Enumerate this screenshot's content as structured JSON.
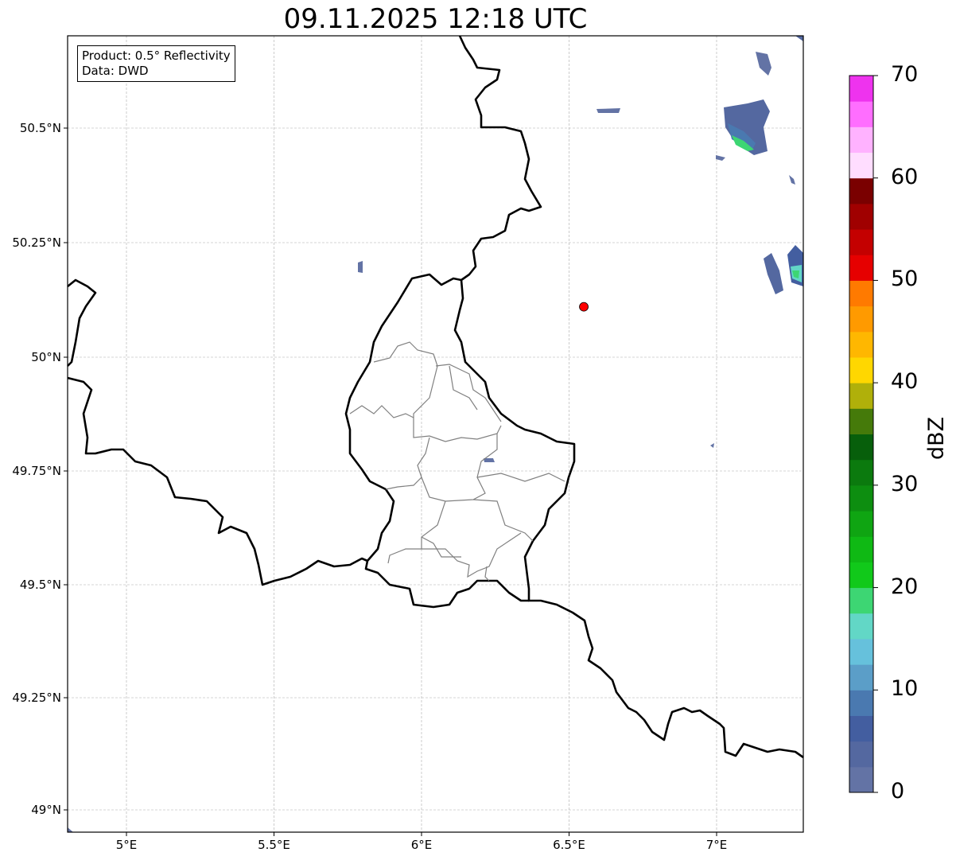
{
  "title": "09.11.2025 12:18 UTC",
  "info": {
    "product": "Product: 0.5° Reflectivity",
    "source": "Data: DWD"
  },
  "map": {
    "extent_lon": [
      4.8,
      7.3
    ],
    "extent_lat": [
      48.95,
      50.7
    ],
    "lon_ticks": [
      {
        "v": 5,
        "label": "5°E"
      },
      {
        "v": 5.5,
        "label": "5.5°E"
      },
      {
        "v": 6,
        "label": "6°E"
      },
      {
        "v": 6.5,
        "label": "6.5°E"
      },
      {
        "v": 7,
        "label": "7°E"
      }
    ],
    "lat_ticks": [
      {
        "v": 50.5,
        "label": "50.5°N"
      },
      {
        "v": 50.25,
        "label": "50.25°N"
      },
      {
        "v": 50,
        "label": "50°N"
      },
      {
        "v": 49.75,
        "label": "49.75°N"
      },
      {
        "v": 49.5,
        "label": "49.5°N"
      },
      {
        "v": 49.25,
        "label": "49.25°N"
      },
      {
        "v": 49,
        "label": "49°N"
      }
    ],
    "grid": true,
    "marker": {
      "lon": 6.55,
      "lat": 50.11,
      "color": "#ff0000"
    }
  },
  "colorbar": {
    "label": "dBZ",
    "min": 0,
    "max": 70,
    "step": 2.5,
    "ticks": [
      "0",
      "10",
      "20",
      "30",
      "40",
      "50",
      "60",
      "70"
    ],
    "colors": [
      "#6373a5",
      "#5468a0",
      "#435ea0",
      "#4a79b0",
      "#5b9ec8",
      "#66c1dc",
      "#62d7c6",
      "#3dd673",
      "#11c91a",
      "#0fb914",
      "#0fa512",
      "#0d8e10",
      "#0b7a0e",
      "#075f0b",
      "#457a0a",
      "#b0b00a",
      "#ffd700",
      "#ffb700",
      "#ff9a00",
      "#ff7a00",
      "#e60000",
      "#c40000",
      "#a00000",
      "#7a0000",
      "#ffddff",
      "#ffb2ff",
      "#ff6eff",
      "#ee33ee"
    ]
  }
}
